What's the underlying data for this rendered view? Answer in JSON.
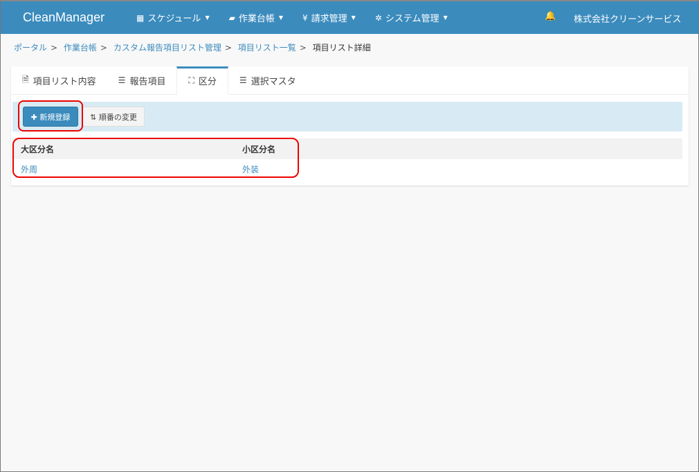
{
  "navbar": {
    "brand": "CleanManager",
    "menus": [
      {
        "icon": "calendar-icon",
        "glyph": "▦",
        "label": "スケジュール"
      },
      {
        "icon": "book-icon",
        "glyph": "▰",
        "label": "作業台帳"
      },
      {
        "icon": "yen-icon",
        "glyph": "¥",
        "label": "請求管理"
      },
      {
        "icon": "gears-icon",
        "glyph": "✲",
        "label": "システム管理"
      }
    ],
    "bell_glyph": "🔔",
    "company": "株式会社クリーンサービス"
  },
  "breadcrumb": {
    "items": [
      "ポータル",
      "作業台帳",
      "カスタム報告項目リスト管理",
      "項目リスト一覧"
    ],
    "current": "項目リスト詳細",
    "sep": ">"
  },
  "tabs": [
    {
      "glyph": "🗎",
      "label": "項目リスト内容"
    },
    {
      "glyph": "☰",
      "label": "報告項目"
    },
    {
      "glyph": "⛶",
      "label": "区分"
    },
    {
      "glyph": "☰",
      "label": "選択マスタ"
    }
  ],
  "toolbar": {
    "new_label": "✚ 新規登録",
    "order_label": "⇅ 順番の変更"
  },
  "table": {
    "headers": [
      "大区分名",
      "小区分名"
    ],
    "rows": [
      [
        "外周",
        "外装"
      ]
    ]
  }
}
